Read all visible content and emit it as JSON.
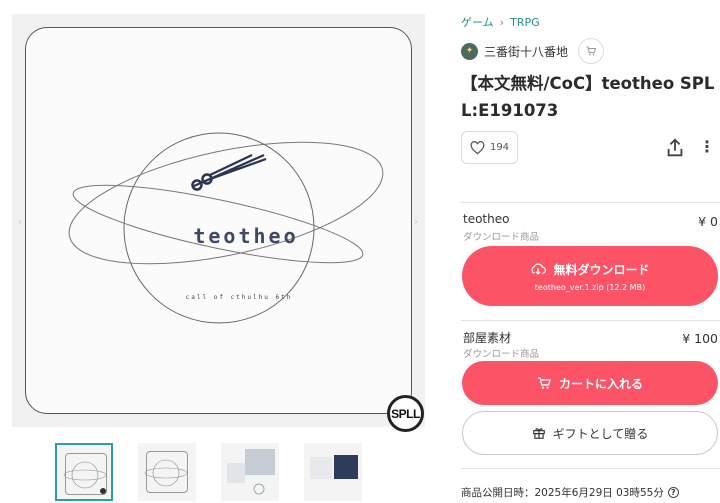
{
  "breadcrumbs": [
    "ゲーム",
    "TRPG"
  ],
  "shop": {
    "name": "三番街十八番地"
  },
  "product": {
    "title": "【本文無料/CoC】teotheo SPLL:E191073",
    "likes": "194"
  },
  "cover": {
    "logo": "teotheo",
    "subtitle": "call of cthulhu 6th",
    "badge": "SPLL"
  },
  "items": [
    {
      "name": "teotheo",
      "type": "ダウンロード商品",
      "price": "¥ 0",
      "button_label": "無料ダウンロード",
      "file": "teotheo_ver.1.zip (12.2 MB)"
    },
    {
      "name": "部屋素材",
      "type": "ダウンロード商品",
      "price": "¥ 100",
      "button_label": "カートに入れる"
    }
  ],
  "gift_label": "ギフトとして贈る",
  "publish": {
    "label": "商品公開日時：2025年6月29日 03時55分"
  },
  "colors": {
    "accent": "#fc5367",
    "link": "#2a8c8c",
    "thumb_selected": "#2aa0a4"
  },
  "icons": [
    "heart-icon",
    "share-icon",
    "more-icon",
    "cloud-download-icon",
    "cart-icon",
    "gift-icon",
    "help-icon"
  ]
}
